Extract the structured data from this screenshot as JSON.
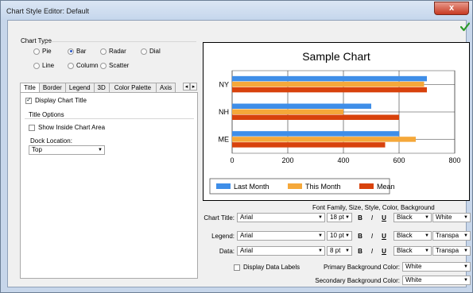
{
  "window": {
    "title": "Chart Style Editor: Default",
    "close_glyph": "x",
    "ok_icon": "green-check-icon"
  },
  "chart_type": {
    "label": "Chart Type",
    "options": [
      {
        "label": "Pie",
        "selected": false
      },
      {
        "label": "Bar",
        "selected": true
      },
      {
        "label": "Radar",
        "selected": false
      },
      {
        "label": "Dial",
        "selected": false
      },
      {
        "label": "Line",
        "selected": false
      },
      {
        "label": "Column",
        "selected": false
      },
      {
        "label": "Scatter",
        "selected": false
      }
    ]
  },
  "tabs": [
    "Title",
    "Border",
    "Legend",
    "3D",
    "Color Palette",
    "Axis"
  ],
  "title_tab": {
    "display_title": "Display Chart Title",
    "display_title_checked": true,
    "options_label": "Title Options",
    "show_inside": "Show Inside Chart Area",
    "show_inside_checked": false,
    "dock_label": "Dock Location:",
    "dock_value": "Top"
  },
  "chart_data": {
    "type": "bar",
    "title": "Sample Chart",
    "categories": [
      "NY",
      "NH",
      "ME"
    ],
    "series": [
      {
        "name": "Last Month",
        "color": "#3f8ee8",
        "values": [
          700,
          500,
          600
        ]
      },
      {
        "name": "This Month",
        "color": "#f5a83a",
        "values": [
          690,
          400,
          660
        ]
      },
      {
        "name": "Mean",
        "color": "#d8420c",
        "values": [
          700,
          600,
          550
        ]
      }
    ],
    "xlim": [
      0,
      800
    ],
    "xticks": [
      "0",
      "200",
      "400",
      "600",
      "800"
    ],
    "grid": true,
    "legend": "bottom",
    "orientation": "horizontal"
  },
  "font_section": {
    "heading": "Font Family, Size, Style, Color, Background",
    "rows": [
      {
        "label": "Chart Title:",
        "font": "Arial",
        "size": "18 pt",
        "color": "Black",
        "background": "White"
      },
      {
        "label": "Legend:",
        "font": "Arial",
        "size": "10 pt",
        "color": "Black",
        "background": "Transpa"
      },
      {
        "label": "Data:",
        "font": "Arial",
        "size": "8 pt",
        "color": "Black",
        "background": "Transpa"
      }
    ],
    "bold": "B",
    "italic": "I",
    "underline": "U",
    "display_data_labels": "Display Data Labels",
    "display_data_labels_checked": false,
    "primary_bg_label": "Primary Background Color:",
    "primary_bg_value": "White",
    "secondary_bg_label": "Secondary Background Color:",
    "secondary_bg_value": "White"
  }
}
